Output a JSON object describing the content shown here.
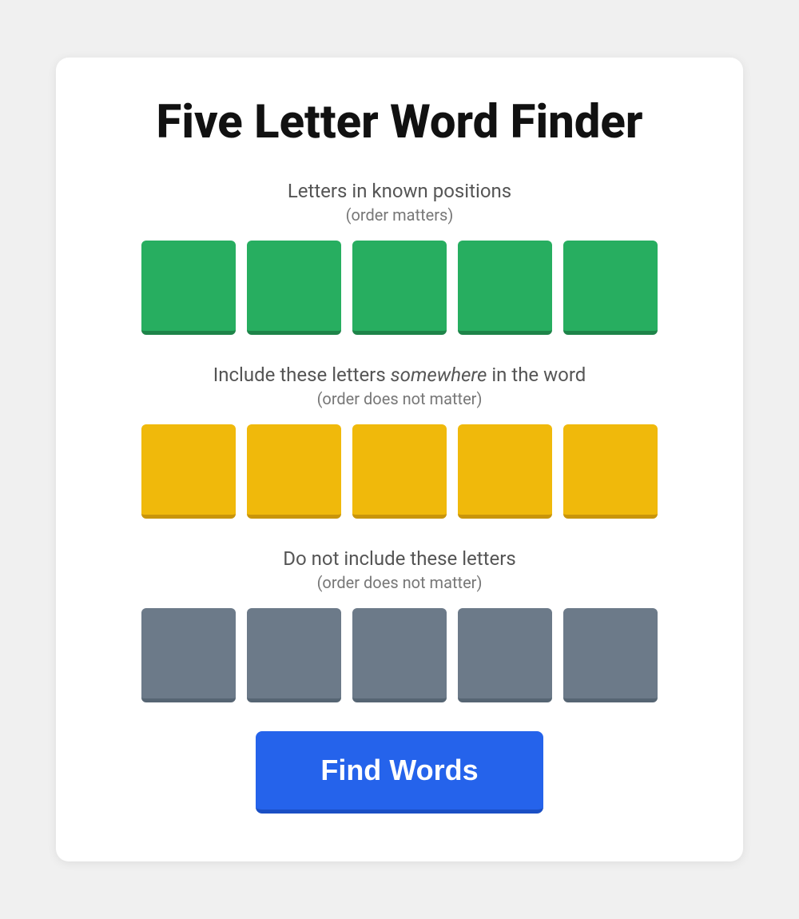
{
  "page": {
    "title": "Five Letter Word Finder",
    "sections": [
      {
        "id": "known-positions",
        "label": "Letters in known positions",
        "sublabel": "(order matters)",
        "tile_color": "green",
        "tiles": [
          "",
          "",
          "",
          "",
          ""
        ]
      },
      {
        "id": "include-somewhere",
        "label": "Include these letters somewhere in the word",
        "sublabel": "(order does not matter)",
        "tile_color": "yellow",
        "tiles": [
          "",
          "",
          "",
          "",
          ""
        ]
      },
      {
        "id": "exclude-letters",
        "label": "Do not include these letters",
        "sublabel": "(order does not matter)",
        "tile_color": "gray",
        "tiles": [
          "",
          "",
          "",
          "",
          ""
        ]
      }
    ],
    "find_words_button": "Find Words"
  }
}
